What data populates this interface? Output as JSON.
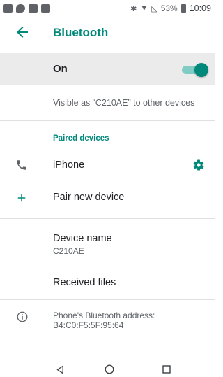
{
  "status_bar": {
    "battery_percent": "53%",
    "time": "10:09",
    "icons": [
      "image-icon",
      "chat-icon",
      "calendar-icon",
      "sim-icon",
      "bluetooth-icon",
      "wifi-icon",
      "signal-icon",
      "battery-icon"
    ]
  },
  "header": {
    "title": "Bluetooth",
    "back_icon": "arrow-back-icon"
  },
  "toggle": {
    "label": "On",
    "state": true,
    "accent": "#00897b"
  },
  "visibility_text": "Visible as “C210AE” to other devices",
  "paired": {
    "header": "Paired devices",
    "devices": [
      {
        "name": "iPhone",
        "icon": "phone-icon",
        "settings_icon": "gear-icon"
      }
    ]
  },
  "pair_new": {
    "label": "Pair new device",
    "icon": "plus-icon"
  },
  "device_name": {
    "title": "Device name",
    "value": "C210AE"
  },
  "received_files": {
    "label": "Received files"
  },
  "address": {
    "line1": "Phone's Bluetooth address:",
    "line2": "B4:C0:F5:5F:95:64",
    "icon": "info-icon"
  },
  "nav_bar": {
    "icons": [
      "back-triangle-icon",
      "home-circle-icon",
      "recents-square-icon"
    ]
  }
}
